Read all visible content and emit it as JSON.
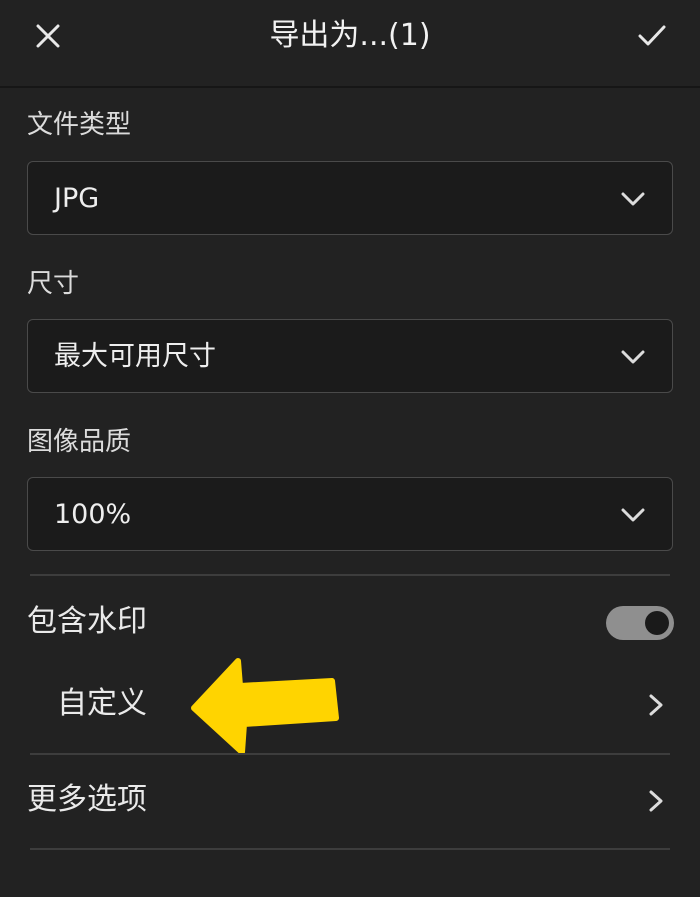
{
  "header": {
    "title": "导出为...(1)",
    "close_icon": "close-icon",
    "confirm_icon": "checkmark-icon"
  },
  "file_type": {
    "label": "文件类型",
    "value": "JPG"
  },
  "size": {
    "label": "尺寸",
    "value": "最大可用尺寸"
  },
  "quality": {
    "label": "图像品质",
    "value": "100%"
  },
  "watermark": {
    "label": "包含水印",
    "enabled": true,
    "custom_label": "自定义"
  },
  "more_options": {
    "label": "更多选项"
  },
  "colors": {
    "background": "#222222",
    "annotation_arrow": "#ffd400",
    "toggle_track": "#8f8f8f"
  }
}
